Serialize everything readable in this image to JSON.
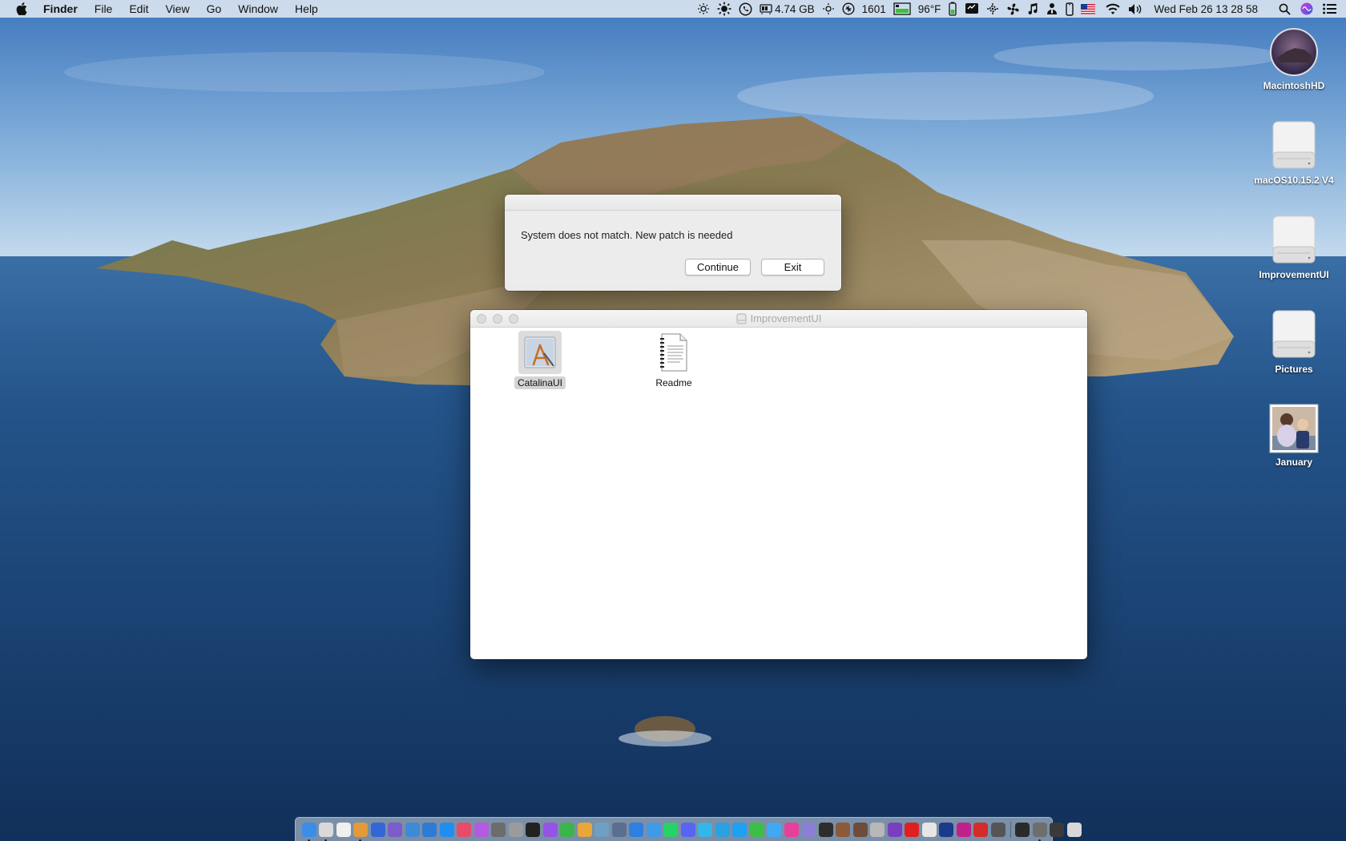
{
  "menubar": {
    "app_name": "Finder",
    "menus": [
      "File",
      "Edit",
      "View",
      "Go",
      "Window",
      "Help"
    ],
    "status": {
      "memory": "4.74 GB",
      "fan_rpm": "1601",
      "temperature": "96°F",
      "clock": "Wed Feb 26  13 28 58"
    }
  },
  "alert": {
    "message": "System does not match. New patch is needed",
    "continue_label": "Continue",
    "exit_label": "Exit"
  },
  "finder_window": {
    "title": "ImprovementUI",
    "items": [
      {
        "name": "CatalinaUI",
        "icon": "app-installer-icon",
        "selected": true
      },
      {
        "name": "Readme",
        "icon": "text-document-icon",
        "selected": false
      }
    ]
  },
  "desktop_icons": [
    {
      "label": "MacintoshHD",
      "icon": "catalina-disk-icon"
    },
    {
      "label": "macOS10.15.2 V4",
      "icon": "external-drive-icon"
    },
    {
      "label": "ImprovementUI",
      "icon": "external-drive-icon"
    },
    {
      "label": "Pictures",
      "icon": "external-drive-icon"
    },
    {
      "label": "January",
      "icon": "photo-thumbnail-icon"
    }
  ],
  "colors": {
    "sky_top": "#4f86c6",
    "sea": "#1f4a7d",
    "menubar": "#eef1f5",
    "dialog": "#ececec"
  },
  "dock": {
    "app_colors": [
      "#3b8ee8",
      "#d9d9d9",
      "#f0f0f0",
      "#e39a3a",
      "#3566d6",
      "#7b5cc9",
      "#3f8ad4",
      "#2e7bd6",
      "#1f8ef0",
      "#e84b6a",
      "#b45ae0",
      "#6c6c6c",
      "#9b9b9b",
      "#222222",
      "#9654e6",
      "#3bb54a",
      "#e7a73a",
      "#6ea0c4",
      "#5a6f8f",
      "#2d7fe0",
      "#3f9ae8",
      "#25d366",
      "#5865f2",
      "#35b6e8",
      "#2aa1e0",
      "#1da1f2",
      "#3dbe45",
      "#3fa9f5",
      "#e8409a",
      "#8b7fd6",
      "#2d2d2d",
      "#8a5a3a",
      "#6d4c3a",
      "#b8b8b8",
      "#7a3fbf",
      "#e02020",
      "#e6e6e6",
      "#1a3a8a",
      "#c0208a",
      "#d42b2b",
      "#555555"
    ],
    "right_colors": [
      "#2a2a2a",
      "#6e6e6e",
      "#3a3a3a",
      "#d8d8d8"
    ]
  }
}
